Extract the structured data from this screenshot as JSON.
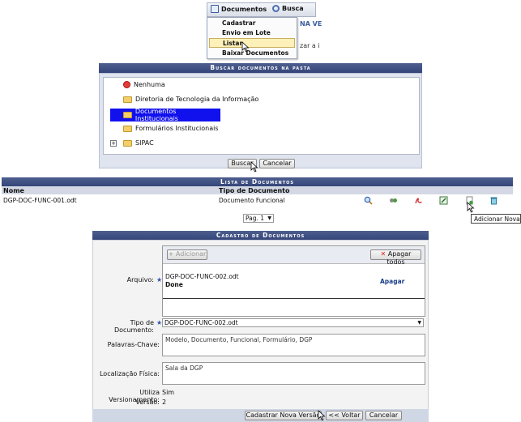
{
  "menu": {
    "documentos": "Documentos",
    "busca": "Busca",
    "items": [
      "Cadastrar",
      "Envio em Lote",
      "Listar",
      "Baixar Documentos"
    ],
    "selected_index": 2,
    "bg_text_1": "NA VE",
    "bg_text_2": "zar a i"
  },
  "search_panel": {
    "title": "Buscar documentos na pasta",
    "tree": [
      "Nenhuma",
      "Diretoria de Tecnologia da Informação",
      "Documentos Institucionais",
      "Formulários Institucionais",
      "SIPAC"
    ],
    "selected_index": 2,
    "buscar": "Buscar",
    "cancelar": "Cancelar"
  },
  "list": {
    "title": "Lista de Documentos",
    "col_nome": "Nome",
    "col_tipo": "Tipo de Documento",
    "rows": [
      {
        "nome": "DGP-DOC-FUNC-001.odt",
        "tipo": "Documento Funcional"
      }
    ],
    "tooltip": "Adicionar Nova Versão",
    "page": "Pag. 1"
  },
  "form": {
    "title": "Cadastro de Documentos",
    "arquivo_label": "Arquivo:",
    "adicionar": "Adicionar",
    "apagar_todos": "Apagar todos",
    "file_name": "DGP-DOC-FUNC-002.odt",
    "file_status": "Done",
    "apagar": "Apagar",
    "tipo_label": "Tipo de Documento:",
    "tipo_value": "DGP-DOC-FUNC-002.odt",
    "palavras_label": "Palavras-Chave:",
    "palavras_value": "Modelo, Documento, Funcional, Formulário, DGP",
    "local_label": "Localização Física:",
    "local_value": "Sala da DGP",
    "versionamento_label": "Utiliza Versionamento:",
    "versionamento_value": "Sim",
    "versao_label": "Versão:",
    "versao_value": "2",
    "btn_cadastrar": "Cadastrar Nova Versão",
    "btn_voltar": "<< Voltar",
    "btn_cancelar": "Cancelar"
  },
  "colors": {
    "header": "#3d4f85",
    "selection": "#1111ee",
    "panel": "#dfe4ee"
  }
}
